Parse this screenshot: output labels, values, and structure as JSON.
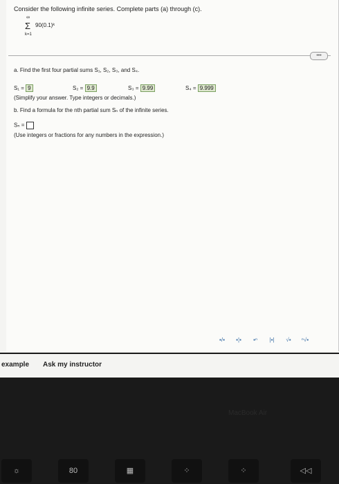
{
  "problem": {
    "instruction": "Consider the following infinite series. Complete parts (a) through (c).",
    "sum_upper": "∞",
    "sum_lower": "k=1",
    "expression": "90(0.1)ᵏ"
  },
  "part_a": {
    "prompt": "a. Find the first four partial sums S₁, S₂, S₃, and S₄.",
    "s1_label": "S₁ =",
    "s1": "9",
    "s2_label": "S₂ =",
    "s2": "9.9",
    "s3_label": "S₃ =",
    "s3": "9.99",
    "s4_label": "S₄ =",
    "s4": "9.999",
    "hint": "(Simplify your answer. Type integers or decimals.)"
  },
  "part_b": {
    "prompt": "b. Find a formula for the nth partial sum Sₙ of the infinite series.",
    "sn_label": "Sₙ =",
    "hint": "(Use integers or fractions for any numbers in the expression.)"
  },
  "toolbar": {
    "items": [
      "▪/▪",
      "▪¦▪",
      "▪ⁿ",
      "|▪|",
      "√▪",
      "ⁿ√▪"
    ]
  },
  "footer": {
    "example": "example",
    "ask": "Ask my instructor"
  },
  "laptop": {
    "brand": "MacBook Air"
  },
  "keys": [
    "☼",
    "80",
    "▦",
    "⁘",
    "⁘",
    "◁◁"
  ]
}
